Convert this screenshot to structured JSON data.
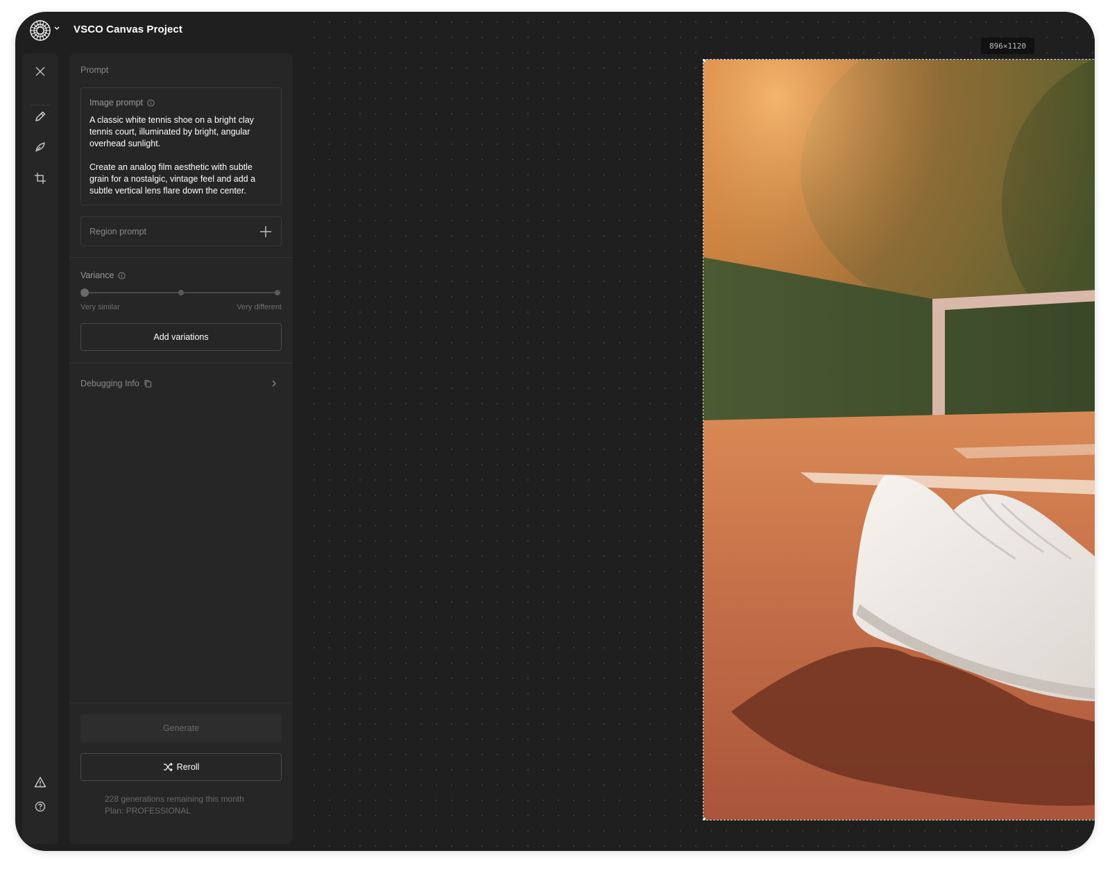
{
  "app": {
    "title": "VSCO Canvas Project",
    "logo_icon": "vsco-logo-icon",
    "menu_caret_icon": "chevron-down-icon"
  },
  "rail": {
    "tools": [
      "close-icon",
      "pencil-icon",
      "brush-icon",
      "crop-icon"
    ],
    "bottom_tools": [
      "warning-icon",
      "help-icon"
    ]
  },
  "panel": {
    "section_title": "Prompt",
    "image_prompt": {
      "label": "Image prompt",
      "text": "A classic white tennis shoe on a bright clay tennis court, illuminated by bright, angular overhead sunlight.\n\nCreate an analog film aesthetic with subtle grain for a nostalgic, vintage feel and add a subtle vertical lens flare down the center."
    },
    "region_prompt": {
      "label": "Region prompt"
    },
    "variance": {
      "label": "Variance",
      "min_label": "Very similar",
      "max_label": "Very different",
      "value": 0
    },
    "add_variations_label": "Add variations",
    "debugging_label": "Debugging Info",
    "generate_label": "Generate",
    "reroll_label": "Reroll",
    "generations_remaining": "228 generations remaining this month",
    "plan": "Plan: PROFESSIONAL"
  },
  "canvas": {
    "dimensions": "896×1120",
    "image_description_icon": "generated-image",
    "tools": [
      "pointer-icon",
      "hand-icon"
    ]
  },
  "colors": {
    "window_bg": "#1f1f1f",
    "panel_bg": "#262626",
    "accent_text": "#ffffff",
    "muted_text": "#8a8a8a"
  }
}
